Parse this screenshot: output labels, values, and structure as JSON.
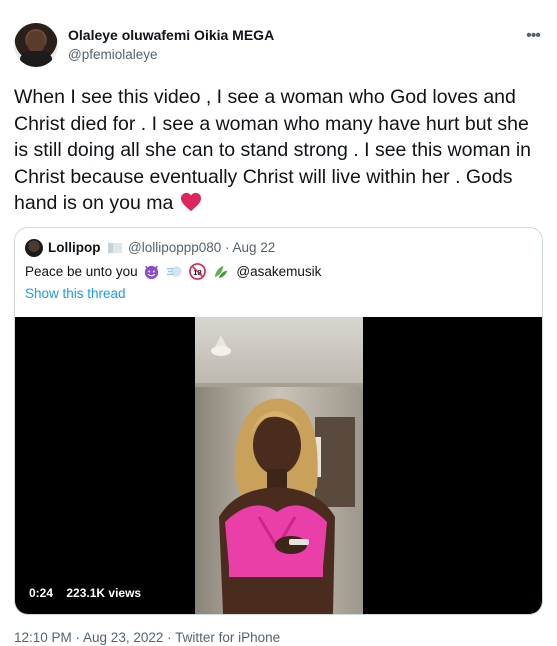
{
  "tweet": {
    "author_name": "Olaleye oluwafemi Oikia MEGA",
    "author_handle": "@pfemiolaleye",
    "more_icon": "ellipsis-icon",
    "text": "When I see this video , I see a woman who God loves and Christ died for . I see a woman who many have hurt but she is still doing all she can to stand strong . I see this woman in Christ because eventually Christ will live within her . Gods hand is on you ma",
    "heart_color": "#e0245e",
    "footer": "12:10 PM · Aug 23, 2022 · Twitter for iPhone"
  },
  "quote": {
    "author_name": "Lollipop",
    "author_handle_date": "@lollipoppp080 · Aug 22",
    "text": "Peace be unto you",
    "mention": "@asakemusik",
    "show_thread": "Show this thread",
    "video": {
      "duration": "0:24",
      "views": "223.1K views"
    }
  },
  "colors": {
    "text": "#0f1419",
    "secondary": "#536471",
    "link": "#1d9bf0",
    "border": "#cfd9de",
    "video_bg": "#000000"
  }
}
